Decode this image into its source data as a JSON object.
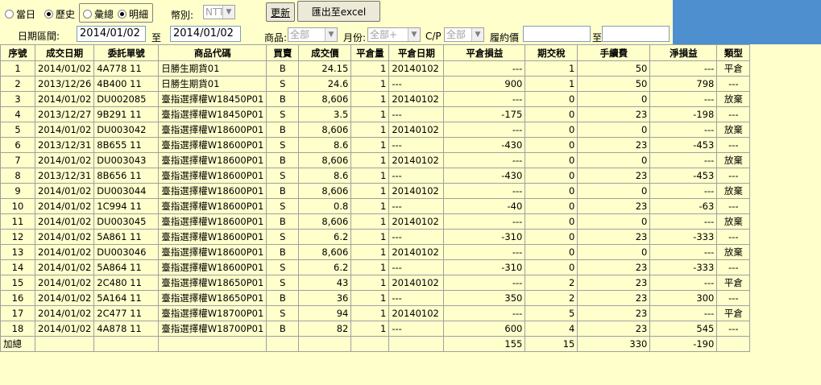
{
  "filters": {
    "radio_today": "當日",
    "radio_history": "歷史",
    "radio_summary": "彙總",
    "radio_detail": "明細",
    "currency_label": "幣別:",
    "currency_value": "NTT",
    "refresh_label": "更新",
    "export_label": "匯出至excel",
    "date_range_label": "日期區間:",
    "date_from": "2014/01/02",
    "date_to_label": "至",
    "date_to": "2014/01/02",
    "product_label": "商品:",
    "product_value": "全部",
    "month_label": "月份:",
    "month_value": "全部+",
    "cp_label": "C/P",
    "cp_value": "全部",
    "strike_label": "履約價",
    "strike_from": "",
    "strike_to_label": "至",
    "strike_to": ""
  },
  "table": {
    "headers": [
      "序號",
      "成交日期",
      "委託單號",
      "商品代碼",
      "買賣",
      "成交價",
      "平倉量",
      "平倉日期",
      "平倉損益",
      "期交稅",
      "手續費",
      "淨損益",
      "類型"
    ],
    "rows": [
      [
        "1",
        "2014/01/02",
        "4A778 11",
        "日勝生期貨01",
        "B",
        "24.15",
        "1",
        "20140102",
        "---",
        "1",
        "50",
        "---",
        "平倉"
      ],
      [
        "2",
        "2013/12/26",
        "4B400 11",
        "日勝生期貨01",
        "S",
        "24.6",
        "1",
        "---",
        "900",
        "1",
        "50",
        "798",
        "---"
      ],
      [
        "3",
        "2014/01/02",
        "DU002085",
        "臺指選擇權W18450P01",
        "B",
        "8,606",
        "1",
        "20140102",
        "---",
        "0",
        "0",
        "---",
        "放棄"
      ],
      [
        "4",
        "2013/12/27",
        "9B291 11",
        "臺指選擇權W18450P01",
        "S",
        "3.5",
        "1",
        "---",
        "-175",
        "0",
        "23",
        "-198",
        "---"
      ],
      [
        "5",
        "2014/01/02",
        "DU003042",
        "臺指選擇權W18600P01",
        "B",
        "8,606",
        "1",
        "20140102",
        "---",
        "0",
        "0",
        "---",
        "放棄"
      ],
      [
        "6",
        "2013/12/31",
        "8B655 11",
        "臺指選擇權W18600P01",
        "S",
        "8.6",
        "1",
        "---",
        "-430",
        "0",
        "23",
        "-453",
        "---"
      ],
      [
        "7",
        "2014/01/02",
        "DU003043",
        "臺指選擇權W18600P01",
        "B",
        "8,606",
        "1",
        "20140102",
        "---",
        "0",
        "0",
        "---",
        "放棄"
      ],
      [
        "8",
        "2013/12/31",
        "8B656 11",
        "臺指選擇權W18600P01",
        "S",
        "8.6",
        "1",
        "---",
        "-430",
        "0",
        "23",
        "-453",
        "---"
      ],
      [
        "9",
        "2014/01/02",
        "DU003044",
        "臺指選擇權W18600P01",
        "B",
        "8,606",
        "1",
        "20140102",
        "---",
        "0",
        "0",
        "---",
        "放棄"
      ],
      [
        "10",
        "2014/01/02",
        "1C994 11",
        "臺指選擇權W18600P01",
        "S",
        "0.8",
        "1",
        "---",
        "-40",
        "0",
        "23",
        "-63",
        "---"
      ],
      [
        "11",
        "2014/01/02",
        "DU003045",
        "臺指選擇權W18600P01",
        "B",
        "8,606",
        "1",
        "20140102",
        "---",
        "0",
        "0",
        "---",
        "放棄"
      ],
      [
        "12",
        "2014/01/02",
        "5A861 11",
        "臺指選擇權W18600P01",
        "S",
        "6.2",
        "1",
        "---",
        "-310",
        "0",
        "23",
        "-333",
        "---"
      ],
      [
        "13",
        "2014/01/02",
        "DU003046",
        "臺指選擇權W18600P01",
        "B",
        "8,606",
        "1",
        "20140102",
        "---",
        "0",
        "0",
        "---",
        "放棄"
      ],
      [
        "14",
        "2014/01/02",
        "5A864 11",
        "臺指選擇權W18600P01",
        "S",
        "6.2",
        "1",
        "---",
        "-310",
        "0",
        "23",
        "-333",
        "---"
      ],
      [
        "15",
        "2014/01/02",
        "2C480 11",
        "臺指選擇權W18650P01",
        "S",
        "43",
        "1",
        "20140102",
        "---",
        "2",
        "23",
        "---",
        "平倉"
      ],
      [
        "16",
        "2014/01/02",
        "5A164 11",
        "臺指選擇權W18650P01",
        "B",
        "36",
        "1",
        "---",
        "350",
        "2",
        "23",
        "300",
        "---"
      ],
      [
        "17",
        "2014/01/02",
        "2C477 11",
        "臺指選擇權W18700P01",
        "S",
        "94",
        "1",
        "20140102",
        "---",
        "5",
        "23",
        "---",
        "平倉"
      ],
      [
        "18",
        "2014/01/02",
        "4A878 11",
        "臺指選擇權W18700P01",
        "B",
        "82",
        "1",
        "---",
        "600",
        "4",
        "23",
        "545",
        "---"
      ]
    ],
    "totals": {
      "label": "加總",
      "pnl": "155",
      "tax": "15",
      "fee": "330",
      "net": "-190"
    }
  }
}
